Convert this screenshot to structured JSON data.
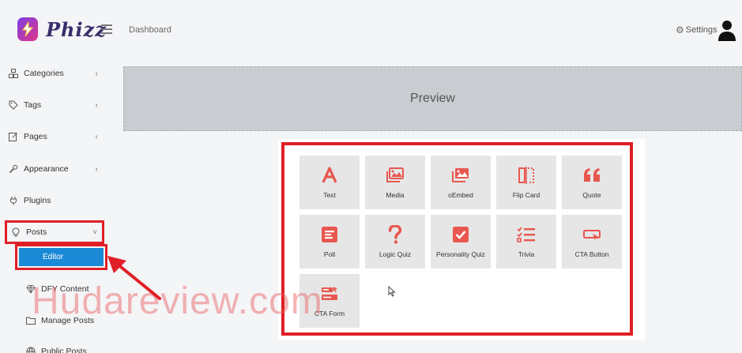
{
  "app": {
    "brand": "Phizz"
  },
  "header": {
    "breadcrumb": "Dashboard",
    "settings_label": "Settings"
  },
  "sidebar": {
    "items": [
      {
        "label": "Categories",
        "icon": "categories-icon"
      },
      {
        "label": "Tags",
        "icon": "tag-icon"
      },
      {
        "label": "Pages",
        "icon": "edit-icon"
      },
      {
        "label": "Appearance",
        "icon": "wrench-icon"
      },
      {
        "label": "Plugins",
        "icon": "plug-icon"
      },
      {
        "label": "Posts",
        "icon": "lightbulb-icon"
      }
    ],
    "sub_items": [
      {
        "label": "Editor"
      },
      {
        "label": "DFY Content",
        "icon": "diamond-icon"
      },
      {
        "label": "Manage Posts",
        "icon": "folder-icon"
      },
      {
        "label": "Public Posts",
        "icon": "globe-icon"
      }
    ]
  },
  "preview": {
    "label": "Preview"
  },
  "blocks": [
    {
      "label": "Text",
      "icon": "text-icon"
    },
    {
      "label": "Media",
      "icon": "image-icon"
    },
    {
      "label": "oEmbed",
      "icon": "embed-icon"
    },
    {
      "label": "Flip Card",
      "icon": "flip-card-icon"
    },
    {
      "label": "Quote",
      "icon": "quote-icon"
    },
    {
      "label": "Poll",
      "icon": "poll-icon"
    },
    {
      "label": "Logic Quiz",
      "icon": "question-icon"
    },
    {
      "label": "Personality Quiz",
      "icon": "checkbox-icon"
    },
    {
      "label": "Trivia",
      "icon": "checklist-icon"
    },
    {
      "label": "CTA Button",
      "icon": "cta-button-icon"
    },
    {
      "label": "CTA Form",
      "icon": "cta-form-icon"
    }
  ],
  "watermark": "Hudareview.com",
  "colors": {
    "accent": "#e8574f",
    "highlight": "#e01f26",
    "editor_button": "#1b8ad6"
  }
}
